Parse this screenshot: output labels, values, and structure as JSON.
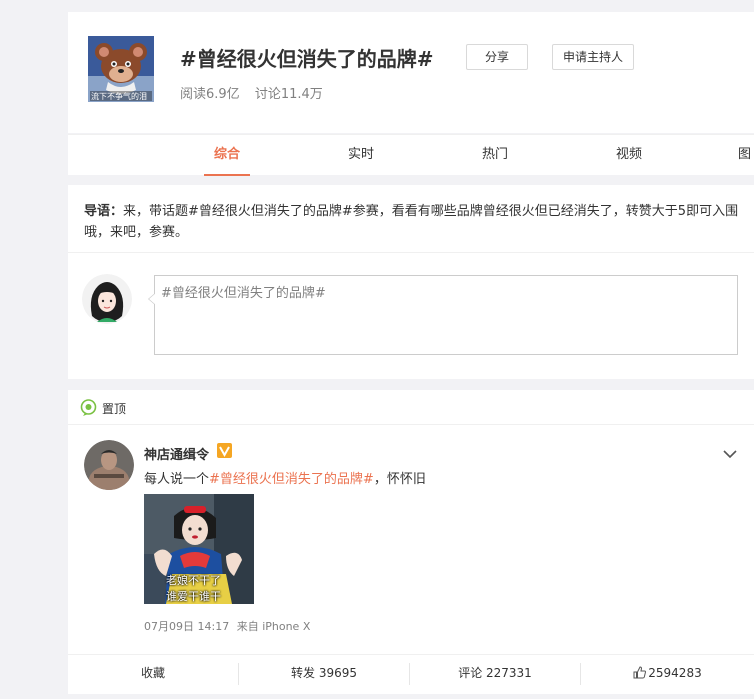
{
  "topic": {
    "title": "#曾经很火但消失了的品牌#",
    "stats": {
      "reads": "阅读6.9亿",
      "discussions": "讨论11.4万"
    },
    "share_label": "分享",
    "host_label": "申请主持人",
    "avatar_caption": "流下不争气的泪"
  },
  "tabs": [
    {
      "label": "综合",
      "active": true
    },
    {
      "label": "实时",
      "active": false
    },
    {
      "label": "热门",
      "active": false
    },
    {
      "label": "视频",
      "active": false
    },
    {
      "label": "图",
      "active": false
    }
  ],
  "guide": {
    "prefix": "导语：",
    "text": "来，带话题#曾经很火但消失了的品牌#参赛，看看有哪些品牌曾经很火但已经消失了，转赞大于5即可入围哦，来吧，参赛。"
  },
  "compose": {
    "value": "#曾经很火但消失了的品牌#"
  },
  "pinned": {
    "label": "置顶",
    "post": {
      "author": "神店通缉令",
      "text_before": "每人说一个",
      "hashtag": "#曾经很火但消失了的品牌#",
      "text_after": "，怀怀旧",
      "image_caption_1": "老娘不干了",
      "image_caption_2": "谁爱干谁干",
      "time": "07月09日 14:17",
      "source": "来自 iPhone X"
    },
    "actions": {
      "collect": "收藏",
      "repost": "转发 39695",
      "comment": "评论 227331",
      "like": "2594283"
    }
  },
  "colors": {
    "accent": "#eb7350",
    "vip": "#f5a623"
  }
}
